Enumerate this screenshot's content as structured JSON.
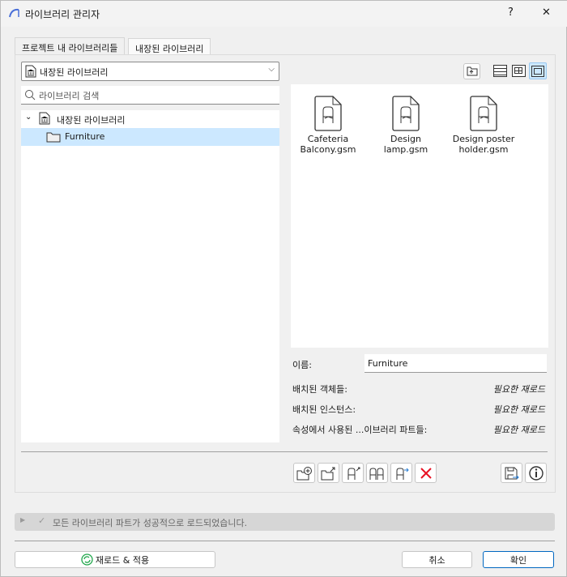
{
  "window": {
    "title": "라이브러리 관리자",
    "help": "?",
    "close": "✕"
  },
  "tabs": [
    {
      "label": "프로젝트 내 라이브러리들"
    },
    {
      "label": "내장된 라이브러리"
    }
  ],
  "library_select": {
    "value": "내장된 라이브러리"
  },
  "search": {
    "placeholder": "라이브러리 검색"
  },
  "tree": {
    "root": "내장된 라이브러리",
    "children": [
      {
        "label": "Furniture",
        "selected": true
      }
    ]
  },
  "files": [
    {
      "name1": "Cafeteria",
      "name2": "Balcony.gsm"
    },
    {
      "name1": "Design",
      "name2": "lamp.gsm"
    },
    {
      "name1": "Design poster",
      "name2": "holder.gsm"
    }
  ],
  "details": {
    "name_label": "이름:",
    "name_value": "Furniture",
    "rows": [
      {
        "label": "배치된 객체들:",
        "value": "필요한 재로드"
      },
      {
        "label": "배치된 인스턴스:",
        "value": "필요한 재로드"
      },
      {
        "label": "속성에서 사용된 ...이브러리 파트들:",
        "value": "필요한 재로드"
      }
    ]
  },
  "status": {
    "message": "모든 라이브러리 파트가 성공적으로 로드되었습니다."
  },
  "footer": {
    "reload_apply": "재로드 & 적용",
    "cancel": "취소",
    "ok": "확인"
  },
  "colors": {
    "accent": "#0067c0",
    "selection": "#cce8ff",
    "delete": "#e81123",
    "reload": "#1fa64a"
  }
}
